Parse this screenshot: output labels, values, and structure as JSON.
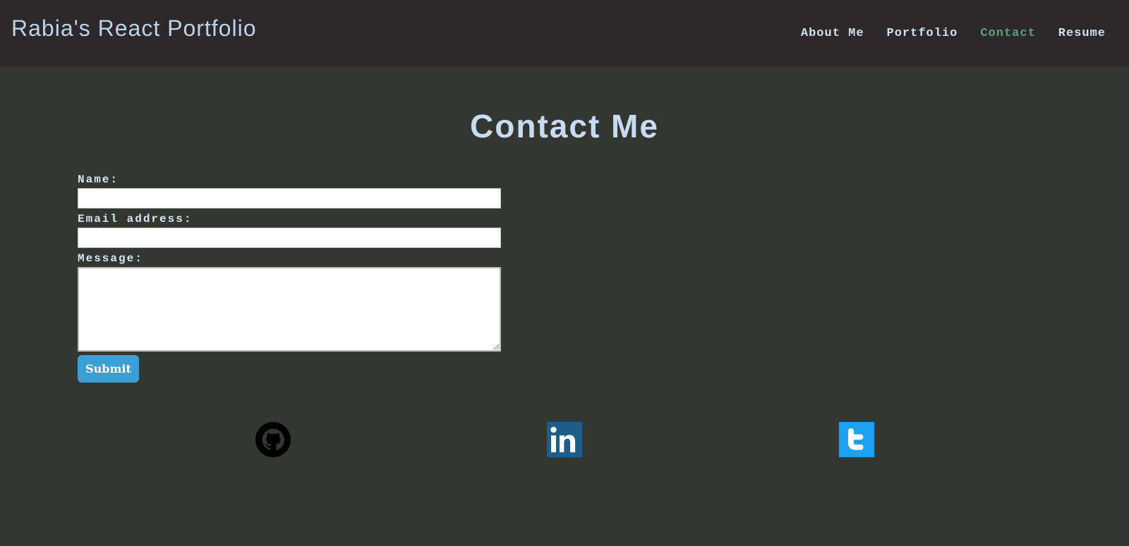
{
  "header": {
    "brand": "Rabia's React Portfolio",
    "nav": [
      {
        "label": "About Me",
        "active": false
      },
      {
        "label": "Portfolio",
        "active": false
      },
      {
        "label": "Contact",
        "active": true
      },
      {
        "label": "Resume",
        "active": false
      }
    ]
  },
  "main": {
    "title": "Contact Me",
    "form": {
      "name_label": "Name:",
      "name_value": "",
      "email_label": "Email address:",
      "email_value": "",
      "message_label": "Message:",
      "message_value": "",
      "submit_label": "Submit"
    },
    "social": [
      {
        "icon": "github-icon",
        "color": "#000000"
      },
      {
        "icon": "linkedin-icon",
        "color": "#1d5e8a"
      },
      {
        "icon": "twitter-icon",
        "color": "#1da1f2"
      }
    ]
  },
  "colors": {
    "header_bg": "#2d2829",
    "page_bg": "#343731",
    "text_light": "#c7dcf0",
    "nav_active": "#5aa37a",
    "button_bg": "#3a9fd6"
  }
}
